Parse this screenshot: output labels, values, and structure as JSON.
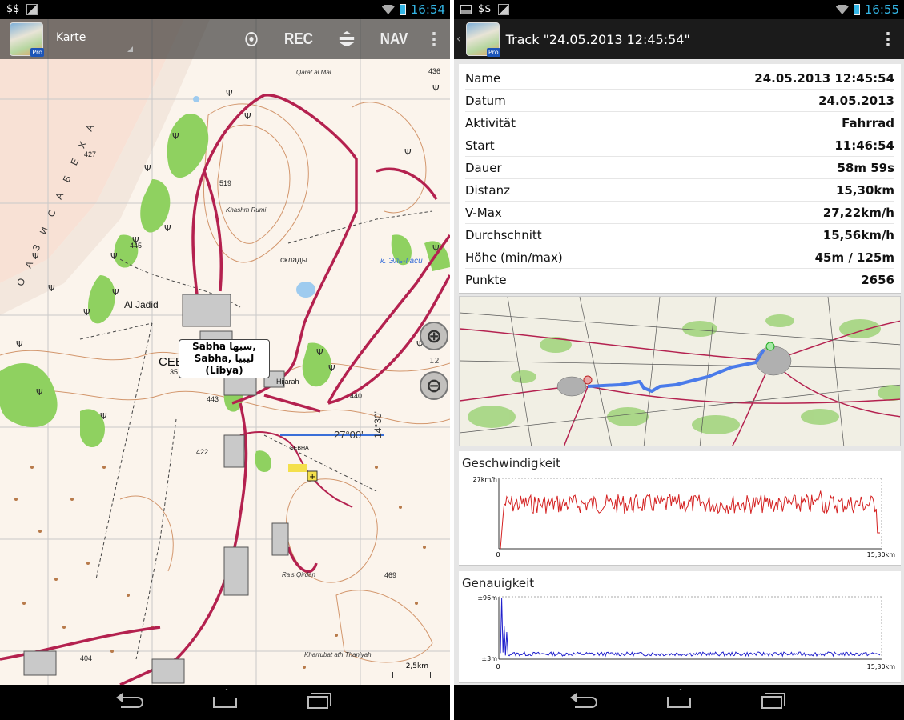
{
  "left": {
    "status": {
      "carrier": "$$",
      "time": "16:54"
    },
    "actionbar": {
      "spinner_label": "Karte",
      "rec_label": "REC",
      "nav_label": "NAV"
    },
    "map": {
      "popup_line1": "Sabha سبها,",
      "popup_line2": "Sabha, ليبيا (Libya)",
      "zoom_level": "12",
      "scale_label": "2,5km",
      "place_labels": {
        "al_jadid": "Al Jadid",
        "sebkha": "СЕБХА",
        "sebkha_num": "35,2",
        "qarat": "Qarat al Mal",
        "khashm": "Khashm Rumi",
        "sklady": "склады",
        "el_gasi": "к. Эль-Гаси",
        "hijarah": "Hijarah",
        "sebha_airport": "SEBHA",
        "ras_qirdan": "Ra's Qirdan",
        "kharrubat": "Kharrubat ath Thaniyah",
        "lat_label": "27°00'",
        "lon_label": "14°30'",
        "elev_427": "427",
        "elev_445": "445",
        "elev_519": "519",
        "elev_436": "436",
        "elev_443": "443",
        "elev_440": "440",
        "elev_422": "422",
        "elev_404": "404",
        "elev_469": "469",
        "vertical_text": "О А З И С А Б Е Х А"
      }
    }
  },
  "right": {
    "status": {
      "carrier": "$$",
      "time": "16:55"
    },
    "actionbar": {
      "title": "Track \"24.05.2013 12:45:54\""
    },
    "info": [
      {
        "label": "Name",
        "value": "24.05.2013 12:45:54"
      },
      {
        "label": "Datum",
        "value": "24.05.2013"
      },
      {
        "label": "Aktivität",
        "value": "Fahrrad"
      },
      {
        "label": "Start",
        "value": "11:46:54"
      },
      {
        "label": "Dauer",
        "value": "58m 59s"
      },
      {
        "label": "Distanz",
        "value": "15,30km"
      },
      {
        "label": "V-Max",
        "value": "27,22km/h"
      },
      {
        "label": "Durchschnitt",
        "value": "15,56km/h"
      },
      {
        "label": "Höhe (min/max)",
        "value": "45m / 125m"
      },
      {
        "label": "Punkte",
        "value": "2656"
      }
    ],
    "speed_graph": {
      "title": "Geschwindigkeit",
      "y_max": "27km/h",
      "x_min": "0",
      "x_max": "15,30km",
      "color": "#d42020"
    },
    "accuracy_graph": {
      "title": "Genauigkeit",
      "y_max": "±96m",
      "y_min": "±3m",
      "x_min": "0",
      "x_max": "15,30km",
      "color": "#2020cc"
    }
  },
  "colors": {
    "time_accent": "#33b5e5",
    "road": "#b4214f",
    "vegetation": "#8fd160",
    "track": "#4a7bea"
  }
}
